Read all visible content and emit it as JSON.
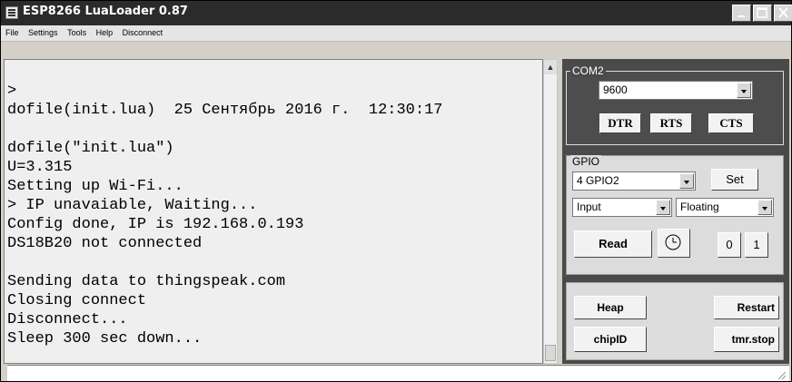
{
  "window": {
    "title": "ESP8266 LuaLoader 0.87"
  },
  "menu": [
    "File",
    "Settings",
    "Tools",
    "Help",
    "Disconnect"
  ],
  "terminal": {
    "lines": [
      ">",
      "dofile(init.lua)  25 Сентябрь 2016 г.  12:30:17",
      "",
      "dofile(\"init.lua\")",
      "U=3.315",
      "Setting up Wi-Fi...",
      "> IP unavaiable, Waiting...",
      "Config done, IP is 192.168.0.193",
      "DS18B20 not connected",
      "",
      "Sending data to thingspeak.com",
      "Closing connect",
      "Disconnect...",
      "Sleep 300 sec down..."
    ]
  },
  "com": {
    "legend": "COM2",
    "baud": "9600",
    "buttons": {
      "dtr": "DTR",
      "rts": "RTS",
      "cts": "CTS"
    }
  },
  "gpio": {
    "legend": "GPIO",
    "pin": "4 GPIO2",
    "set_label": "Set",
    "mode": "Input",
    "pull": "Floating",
    "read_label": "Read",
    "zero_label": "0",
    "one_label": "1"
  },
  "misc": {
    "heap_label": "Heap",
    "restart_label": "Restart",
    "chipid_label": "chipID",
    "tmrstop_label": "tmr.stop"
  }
}
